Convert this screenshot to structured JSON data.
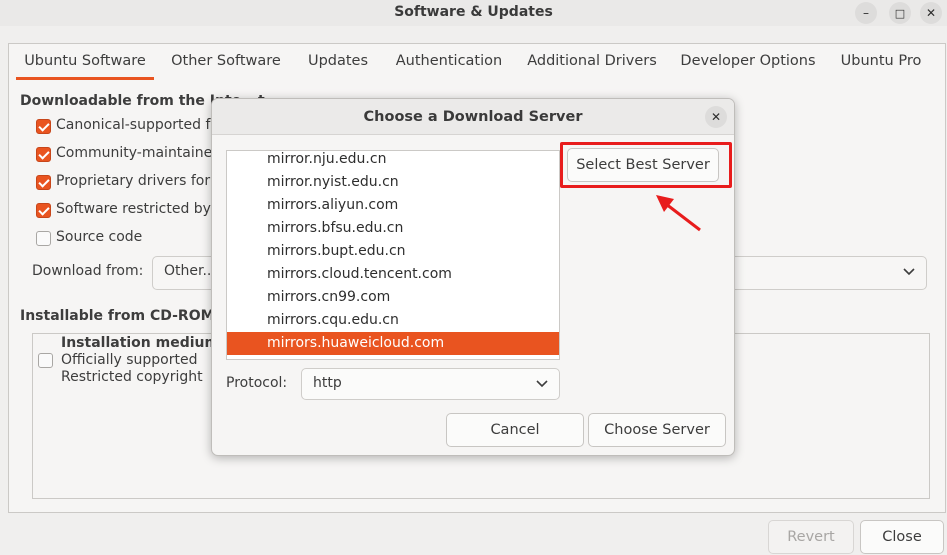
{
  "window": {
    "title": "Software & Updates",
    "controls": {
      "minimize": "–",
      "maximize": "□",
      "close": "✕"
    }
  },
  "tabs": [
    {
      "label": "Ubuntu Software",
      "active": true
    },
    {
      "label": "Other Software",
      "active": false
    },
    {
      "label": "Updates",
      "active": false
    },
    {
      "label": "Authentication",
      "active": false
    },
    {
      "label": "Additional Drivers",
      "active": false
    },
    {
      "label": "Developer Options",
      "active": false
    },
    {
      "label": "Ubuntu Pro",
      "active": false
    }
  ],
  "downloadable": {
    "heading": "Downloadable from the Inte",
    "heading_tail": "t",
    "checkboxes": [
      {
        "label": "Canonical-supported fr",
        "checked": true
      },
      {
        "label": "Community-maintained",
        "checked": true
      },
      {
        "label": "Proprietary drivers for",
        "checked": true
      },
      {
        "label": "Software restricted by c",
        "checked": true
      },
      {
        "label": "Source code",
        "checked": false
      }
    ],
    "download_from_label": "Download from:",
    "download_from_value": "Other..."
  },
  "installable": {
    "heading": "Installable from CD-ROM/D",
    "medium_title": "Installation medium v",
    "medium_line1": "Officially supported",
    "medium_line2": "Restricted copyright",
    "checked": false
  },
  "footer": {
    "revert_label": "Revert",
    "close_label": "Close"
  },
  "dialog": {
    "title": "Choose a Download Server",
    "close_icon": "✕",
    "select_best_label": "Select Best Server",
    "mirrors": [
      {
        "name": "mirror.nju.edu.cn",
        "selected": false
      },
      {
        "name": "mirror.nyist.edu.cn",
        "selected": false
      },
      {
        "name": "mirrors.aliyun.com",
        "selected": false
      },
      {
        "name": "mirrors.bfsu.edu.cn",
        "selected": false
      },
      {
        "name": "mirrors.bupt.edu.cn",
        "selected": false
      },
      {
        "name": "mirrors.cloud.tencent.com",
        "selected": false
      },
      {
        "name": "mirrors.cn99.com",
        "selected": false
      },
      {
        "name": "mirrors.cqu.edu.cn",
        "selected": false
      },
      {
        "name": "mirrors.huaweicloud.com",
        "selected": true
      }
    ],
    "protocol_label": "Protocol:",
    "protocol_value": "http",
    "cancel_label": "Cancel",
    "choose_label": "Choose Server"
  },
  "annotation": {
    "highlight_color": "#e81c1c"
  },
  "colors": {
    "accent": "#e95420",
    "background": "#f0efee"
  }
}
